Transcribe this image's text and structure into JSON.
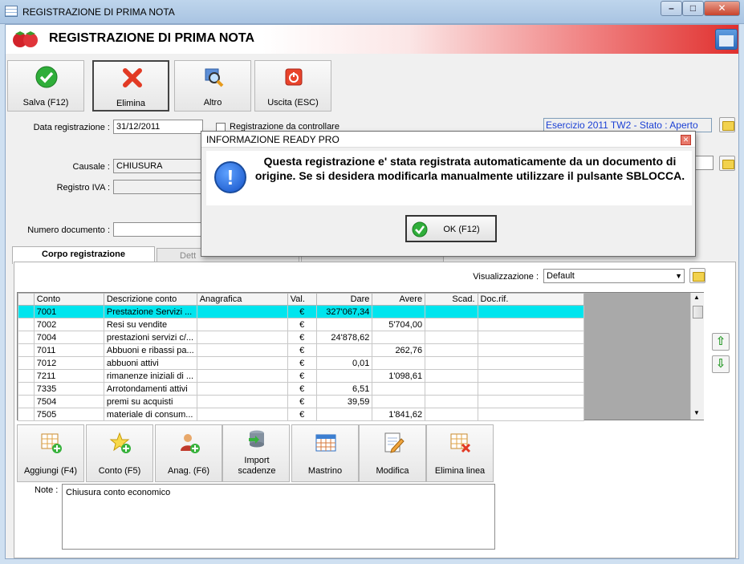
{
  "window": {
    "title": "REGISTRAZIONE DI PRIMA NOTA"
  },
  "header": {
    "title": "REGISTRAZIONE DI PRIMA NOTA"
  },
  "toolbar": {
    "save": "Salva (F12)",
    "delete": "Elimina",
    "other": "Altro",
    "exit": "Uscita (ESC)"
  },
  "form": {
    "date_label": "Data registrazione :",
    "date_value": "31/12/2011",
    "check_label": "Registrazione da controllare",
    "exercise": "Esercizio 2011 TW2 - Stato : Aperto",
    "causale_label": "Causale :",
    "causale_value": "CHIUSURA",
    "registro_label": "Registro IVA :",
    "registro_value": "",
    "numdoc_label": "Numero documento :",
    "numdoc_value": ""
  },
  "tabs": {
    "tab1": "Corpo registrazione",
    "tab2": "Dett"
  },
  "view": {
    "label": "Visualizzazione :",
    "value": "Default"
  },
  "grid": {
    "columns": [
      "",
      "Conto",
      "Descrizione conto",
      "Anagrafica",
      "Val.",
      "Dare",
      "Avere",
      "Scad.",
      "Doc.rif."
    ],
    "rows": [
      [
        "7001",
        "Prestazione Servizi ...",
        "",
        "€",
        "327'067,34",
        "",
        "",
        ""
      ],
      [
        "7002",
        "Resi su vendite",
        "",
        "€",
        "",
        "5'704,00",
        "",
        ""
      ],
      [
        "7004",
        "prestazioni servizi c/...",
        "",
        "€",
        "24'878,62",
        "",
        "",
        ""
      ],
      [
        "7011",
        "Abbuoni e ribassi pa...",
        "",
        "€",
        "",
        "262,76",
        "",
        ""
      ],
      [
        "7012",
        "abbuoni attivi",
        "",
        "€",
        "0,01",
        "",
        "",
        ""
      ],
      [
        "7211",
        "rimanenze iniziali di ...",
        "",
        "€",
        "",
        "1'098,61",
        "",
        ""
      ],
      [
        "7335",
        "Arrotondamenti attivi",
        "",
        "€",
        "6,51",
        "",
        "",
        ""
      ],
      [
        "7504",
        "premi su acquisti",
        "",
        "€",
        "39,59",
        "",
        "",
        ""
      ],
      [
        "7505",
        "materiale di consum...",
        "",
        "€",
        "",
        "1'841,62",
        "",
        ""
      ]
    ]
  },
  "actions": {
    "add": "Aggiungi (F4)",
    "account": "Conto (F5)",
    "anag": "Anag. (F6)",
    "import": "Import scadenze",
    "mastrino": "Mastrino",
    "modify": "Modifica",
    "delete_line": "Elimina linea"
  },
  "notes": {
    "label": "Note :",
    "value": "Chiusura conto economico"
  },
  "dialog": {
    "title": "INFORMAZIONE READY PRO",
    "message": "Questa registrazione e' stata registrata automaticamente da un documento di origine. Se si desidera modificarla manualmente utilizzare il pulsante SBLOCCA.",
    "ok": "OK (F12)"
  }
}
